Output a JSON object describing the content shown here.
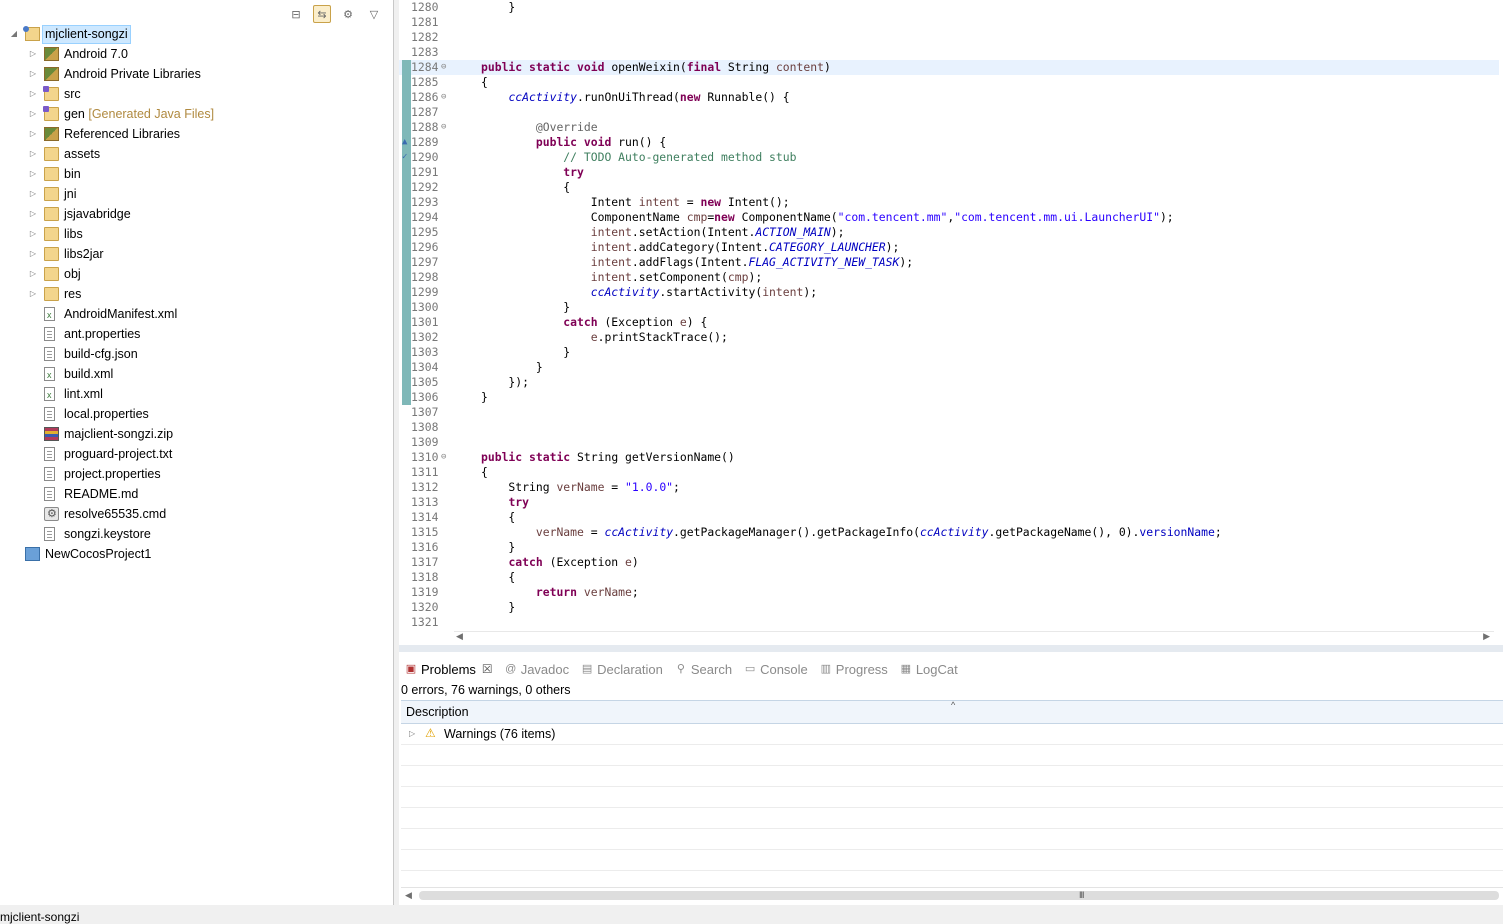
{
  "explorer": {
    "tree": [
      {
        "label": "mjclient-songzi",
        "icon": "project-icon",
        "level": 0,
        "expanded": true,
        "selected": true
      },
      {
        "label": "Android 7.0",
        "icon": "library-icon",
        "level": 1
      },
      {
        "label": "Android Private Libraries",
        "icon": "library-icon",
        "level": 1
      },
      {
        "label": "src",
        "icon": "source-folder-icon",
        "level": 1
      },
      {
        "label": "gen",
        "decoration": "[Generated Java Files]",
        "icon": "source-folder-icon",
        "level": 1
      },
      {
        "label": "Referenced Libraries",
        "icon": "library-icon",
        "level": 1
      },
      {
        "label": "assets",
        "icon": "folder-icon",
        "level": 1
      },
      {
        "label": "bin",
        "icon": "folder-icon",
        "level": 1
      },
      {
        "label": "jni",
        "icon": "folder-icon",
        "level": 1
      },
      {
        "label": "jsjavabridge",
        "icon": "folder-icon",
        "level": 1
      },
      {
        "label": "libs",
        "icon": "folder-icon",
        "level": 1
      },
      {
        "label": "libs2jar",
        "icon": "folder-icon",
        "level": 1
      },
      {
        "label": "obj",
        "icon": "folder-icon",
        "level": 1
      },
      {
        "label": "res",
        "icon": "folder-icon",
        "level": 1
      },
      {
        "label": "AndroidManifest.xml",
        "icon": "xml-file-icon",
        "level": 1,
        "leaf": true
      },
      {
        "label": "ant.properties",
        "icon": "file-icon",
        "level": 1,
        "leaf": true
      },
      {
        "label": "build-cfg.json",
        "icon": "file-icon",
        "level": 1,
        "leaf": true
      },
      {
        "label": "build.xml",
        "icon": "xml-file-icon",
        "level": 1,
        "leaf": true
      },
      {
        "label": "lint.xml",
        "icon": "xml-file-icon",
        "level": 1,
        "leaf": true
      },
      {
        "label": "local.properties",
        "icon": "file-icon",
        "level": 1,
        "leaf": true
      },
      {
        "label": "majclient-songzi.zip",
        "icon": "zip-file-icon",
        "level": 1,
        "leaf": true
      },
      {
        "label": "proguard-project.txt",
        "icon": "file-icon",
        "level": 1,
        "leaf": true
      },
      {
        "label": "project.properties",
        "icon": "file-icon",
        "level": 1,
        "leaf": true
      },
      {
        "label": "README.md",
        "icon": "file-icon",
        "level": 1,
        "leaf": true
      },
      {
        "label": "resolve65535.cmd",
        "icon": "gear-file-icon",
        "level": 1,
        "leaf": true
      },
      {
        "label": "songzi.keystore",
        "icon": "file-icon",
        "level": 1,
        "leaf": true
      },
      {
        "label": "NewCocosProject1",
        "icon": "closed-project-icon",
        "level": 0,
        "leaf": true
      }
    ]
  },
  "status_bar": {
    "text": "mjclient-songzi"
  },
  "editor": {
    "lines": [
      {
        "n": "1280",
        "code": "    }"
      },
      {
        "n": "1281",
        "code": ""
      },
      {
        "n": "1282",
        "code": ""
      },
      {
        "n": "1283",
        "code": ""
      },
      {
        "n": "1284",
        "fold": "⊖",
        "current": true,
        "code": "<k>public</k> <k>static</k> <k>void</k> openWeixin(<k>final</k> String <l>content</l>)"
      },
      {
        "n": "1285",
        "code": "{"
      },
      {
        "n": "1286",
        "fold": "⊖",
        "code": "    <sf>ccActivity</sf>.runOnUiThread(<k>new</k> Runnable() {"
      },
      {
        "n": "1287",
        "code": ""
      },
      {
        "n": "1288",
        "fold": "⊖",
        "code": "        <a>@Override</a>"
      },
      {
        "n": "1289",
        "rmark": "▲",
        "code": "        <k>public</k> <k>void</k> run() {"
      },
      {
        "n": "1290",
        "rmark": "✓",
        "code": "            <c>// TODO Auto-generated method stub</c>"
      },
      {
        "n": "1291",
        "code": "            <k>try</k>"
      },
      {
        "n": "1292",
        "code": "            {"
      },
      {
        "n": "1293",
        "code": "                Intent <l>intent</l> = <k>new</k> Intent();"
      },
      {
        "n": "1294",
        "code": "                ComponentName <l>cmp</l>=<k>new</k> ComponentName(<s>\"com.tencent.mm\"</s>,<s>\"com.tencent.mm.ui.LauncherUI\"</s>);"
      },
      {
        "n": "1295",
        "code": "                <l>intent</l>.setAction(Intent.<sf>ACTION_MAIN</sf>);"
      },
      {
        "n": "1296",
        "code": "                <l>intent</l>.addCategory(Intent.<sf>CATEGORY_LAUNCHER</sf>);"
      },
      {
        "n": "1297",
        "code": "                <l>intent</l>.addFlags(Intent.<sf>FLAG_ACTIVITY_NEW_TASK</sf>);"
      },
      {
        "n": "1298",
        "code": "                <l>intent</l>.setComponent(<l>cmp</l>);"
      },
      {
        "n": "1299",
        "code": "                <sf>ccActivity</sf>.startActivity(<l>intent</l>);"
      },
      {
        "n": "1300",
        "code": "            }"
      },
      {
        "n": "1301",
        "code": "            <k>catch</k> (Exception <l>e</l>) {"
      },
      {
        "n": "1302",
        "code": "                <l>e</l>.printStackTrace();"
      },
      {
        "n": "1303",
        "code": "            }"
      },
      {
        "n": "1304",
        "code": "        }"
      },
      {
        "n": "1305",
        "code": "    });"
      },
      {
        "n": "1306",
        "code": "}"
      },
      {
        "n": "1307",
        "code": ""
      },
      {
        "n": "1308",
        "code": ""
      },
      {
        "n": "1309",
        "code": ""
      },
      {
        "n": "1310",
        "fold": "⊖",
        "code": "<k>public</k> <k>static</k> String getVersionName()"
      },
      {
        "n": "1311",
        "code": "{"
      },
      {
        "n": "1312",
        "code": "    String <l>verName</l> = <s>\"1.0.0\"</s>;"
      },
      {
        "n": "1313",
        "code": "    <k>try</k>"
      },
      {
        "n": "1314",
        "code": "    {"
      },
      {
        "n": "1315",
        "code": "        <l>verName</l> = <sf>ccActivity</sf>.getPackageManager().getPackageInfo(<sf>ccActivity</sf>.getPackageName(), 0).<f>versionName</f>;"
      },
      {
        "n": "1316",
        "code": "    }"
      },
      {
        "n": "1317",
        "code": "    <k>catch</k> (Exception <l>e</l>)"
      },
      {
        "n": "1318",
        "code": "    {"
      },
      {
        "n": "1319",
        "code": "        <k>return</k> <l>verName</l>;"
      },
      {
        "n": "1320",
        "code": "    }"
      },
      {
        "n": "1321",
        "code": ""
      }
    ],
    "change_marker_from": "1284",
    "change_marker_to": "1306"
  },
  "problems_view": {
    "tabs": [
      {
        "label": "Problems",
        "icon": "problems-icon",
        "glyph": "▣",
        "active": true
      },
      {
        "label": "Javadoc",
        "icon": "javadoc-icon",
        "glyph": "@"
      },
      {
        "label": "Declaration",
        "icon": "declaration-icon",
        "glyph": "▤"
      },
      {
        "label": "Search",
        "icon": "search-icon",
        "glyph": "⚲"
      },
      {
        "label": "Console",
        "icon": "console-icon",
        "glyph": "▭"
      },
      {
        "label": "Progress",
        "icon": "progress-icon",
        "glyph": "▥"
      },
      {
        "label": "LogCat",
        "icon": "logcat-icon",
        "glyph": "▦"
      }
    ],
    "summary": "0 errors, 76 warnings, 0 others",
    "column_header": "Description",
    "rows": [
      {
        "label": "Warnings (76 items)",
        "icon": "warning-icon"
      }
    ],
    "empty_rows": 7
  }
}
